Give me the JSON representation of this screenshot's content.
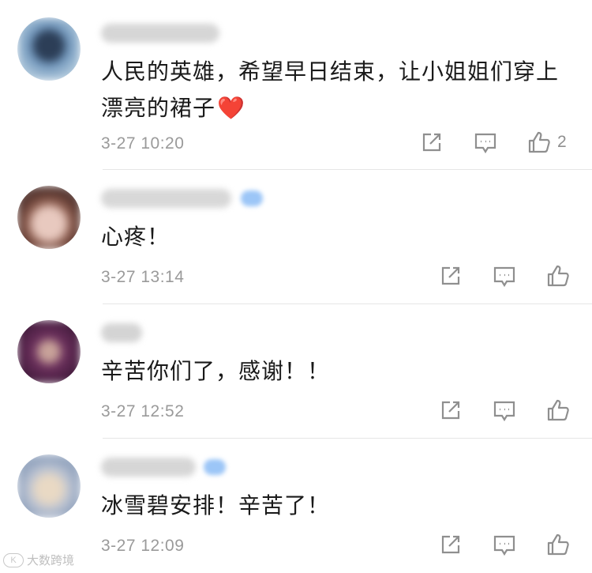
{
  "comments": [
    {
      "text": "人民的英雄，希望早日结束，让小姐姐们穿上漂亮的裙子",
      "emoji": "❤️",
      "time": "3-27 10:20",
      "like_count": "2",
      "avatar_color": "#5b82a8"
    },
    {
      "text": "心疼！",
      "time": "3-27 13:14",
      "avatar_color": "#7a4a40"
    },
    {
      "text": "辛苦你们了，感谢！！",
      "time": "3-27 12:52",
      "avatar_color": "#5e2a55"
    },
    {
      "text": "冰雪碧安排！辛苦了！",
      "time": "3-27 12:09",
      "avatar_color": "#b4b9c6"
    }
  ],
  "icons": {
    "share": "share-icon",
    "reply": "comment-icon",
    "like": "thumbs-up-icon"
  },
  "watermark": {
    "text": "大数跨境"
  }
}
